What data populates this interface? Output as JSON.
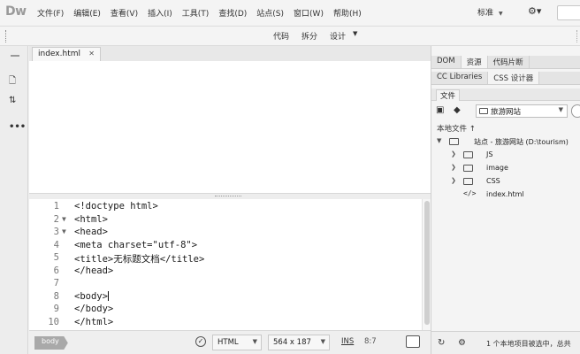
{
  "app": {
    "logo": "Dw"
  },
  "menu": [
    "文件(F)",
    "编辑(E)",
    "查看(V)",
    "插入(I)",
    "工具(T)",
    "查找(D)",
    "站点(S)",
    "窗口(W)",
    "帮助(H)"
  ],
  "workspace": {
    "label": "标准"
  },
  "view_toolbar": {
    "code": "代码",
    "split": "拆分",
    "design": "设计"
  },
  "document": {
    "tab": "index.html"
  },
  "code_lines": [
    {
      "num": "1",
      "fold": "",
      "text": "<!doctype html>"
    },
    {
      "num": "2",
      "fold": "▼",
      "text": "<html>"
    },
    {
      "num": "3",
      "fold": "▼",
      "text": "<head>"
    },
    {
      "num": "4",
      "fold": "",
      "text": "<meta charset=\"utf-8\">"
    },
    {
      "num": "5",
      "fold": "",
      "text": "<title>无标题文档</title>"
    },
    {
      "num": "6",
      "fold": "",
      "text": "</head>"
    },
    {
      "num": "7",
      "fold": "",
      "text": ""
    },
    {
      "num": "8",
      "fold": "",
      "text": "<body>"
    },
    {
      "num": "9",
      "fold": "",
      "text": "</body>"
    },
    {
      "num": "10",
      "fold": "",
      "text": "</html>"
    }
  ],
  "statusbar": {
    "tag": "body",
    "doctype": "HTML",
    "size": "564 x 187",
    "ins": "INS",
    "position": "8:7"
  },
  "panel": {
    "tabs_row1": [
      "DOM",
      "资源",
      "代码片断"
    ],
    "tabs_row2": [
      "CC Libraries",
      "CSS 设计器"
    ],
    "file_tab": "文件",
    "site_select": "旅游网站",
    "local_files": "本地文件 ↑",
    "tree": [
      {
        "label": "站点 - 旅游网站 (D:\\tourism)",
        "type": "site"
      },
      {
        "label": "JS",
        "type": "folder"
      },
      {
        "label": "image",
        "type": "folder"
      },
      {
        "label": "CSS",
        "type": "folder"
      },
      {
        "label": "index.html",
        "type": "file"
      }
    ],
    "status_message": "1 个本地项目被选中，总共"
  },
  "colors": {
    "background": "#f2f2f2",
    "tag_pill": "#a9a9a9"
  }
}
